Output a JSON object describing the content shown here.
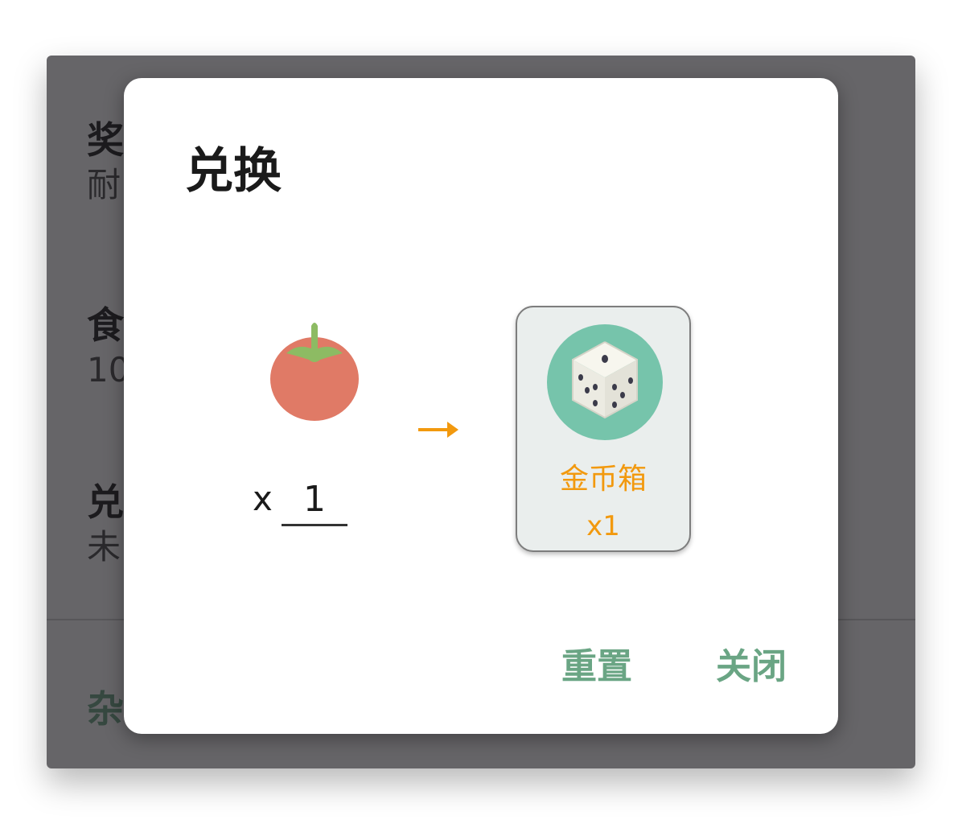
{
  "background_list": {
    "items": [
      {
        "title": "奖",
        "subtitle": "耐"
      },
      {
        "title": "食",
        "subtitle": "10"
      },
      {
        "title": "兑",
        "subtitle": "未"
      }
    ],
    "footer_label": "杂"
  },
  "dialog": {
    "title": "兑换",
    "source_item": {
      "icon": "tomato-icon",
      "quantity_prefix": "x",
      "quantity_value": "1"
    },
    "arrow_icon": "arrow-right-icon",
    "reward": {
      "icon": "dice-icon",
      "name": "金币箱",
      "count": "x1"
    },
    "buttons": {
      "reset_label": "重置",
      "close_label": "关闭"
    }
  },
  "colors": {
    "accent": "#6aa584",
    "reward_text": "#f2990e",
    "arrow": "#f2990e",
    "reward_card_bg": "#eaeeed",
    "reward_avatar_bg": "#76c4ab",
    "tomato": "#e07a66",
    "tomato_leaf": "#8dbb63"
  }
}
